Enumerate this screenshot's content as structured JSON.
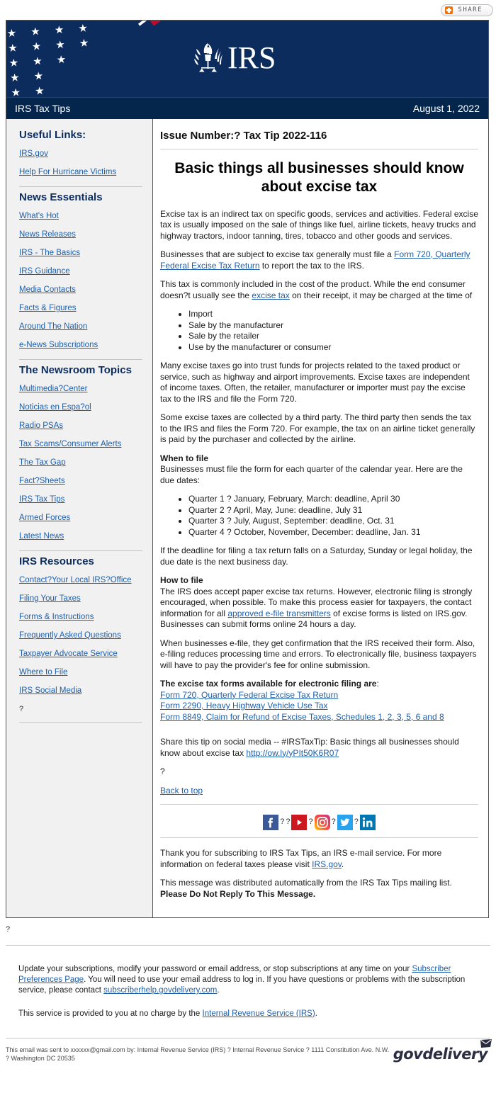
{
  "share": {
    "label": "SHARE",
    "icon": "share-plus-icon"
  },
  "banner": {
    "logo_text": "IRS",
    "flag_alt": "us-flag"
  },
  "titlebar": {
    "title": "IRS Tax Tips",
    "date": "August 1, 2022"
  },
  "sidebar": {
    "useful_links_heading": "Useful Links:",
    "useful_links": [
      "IRS.gov",
      "Help For Hurricane Victims"
    ],
    "news_essentials_heading": "News Essentials",
    "news_essentials": [
      "What's Hot",
      "News Releases",
      "IRS - The Basics",
      "IRS Guidance",
      "Media Contacts",
      "Facts & Figures",
      "Around The Nation",
      "e-News Subscriptions"
    ],
    "newsroom_heading": "The Newsroom Topics",
    "newsroom_topics": [
      "Multimedia?Center",
      "Noticias en Espa?ol",
      "Radio PSAs",
      "Tax Scams/Consumer Alerts",
      "The Tax Gap",
      "Fact?Sheets",
      "IRS Tax Tips",
      "Armed Forces",
      "Latest News"
    ],
    "resources_heading": "IRS Resources",
    "resources": [
      "Contact?Your Local IRS?Office",
      "Filing Your Taxes",
      "Forms & Instructions",
      "Frequently Asked Questions",
      "Taxpayer Advocate Service",
      "Where to File",
      "IRS Social Media"
    ],
    "resources_trailing": "?"
  },
  "content": {
    "issue_number": "Issue Number:? Tax Tip 2022-116",
    "headline": "Basic things all businesses should know about excise tax",
    "p1": "Excise tax is an indirect tax on specific goods, services and activities. Federal excise tax is usually imposed on the sale of things like fuel, airline tickets, heavy trucks and highway tractors, indoor tanning, tires, tobacco and other goods and services.",
    "p2_before": "Businesses that are subject to excise tax generally must file a ",
    "p2_link": "Form 720, Quarterly Federal Excise Tax Return",
    "p2_after": " to report the tax to the IRS.",
    "p3_before": "This tax is commonly included in the cost of the product. While the end consumer doesn?t usually see the ",
    "p3_link": "excise tax",
    "p3_after": " on their receipt, it may be charged at the time of",
    "list1": [
      "Import",
      "Sale by the manufacturer",
      "Sale by the retailer",
      "Use by the manufacturer or consumer"
    ],
    "p4": "Many excise taxes go into trust funds for projects related to the taxed product or service, such as highway and airport improvements. Excise taxes are independent of income taxes. Often, the retailer, manufacturer or importer must pay the excise tax to the IRS and file the Form 720.",
    "p5": "Some excise taxes are collected by a third party. The third party then sends the tax to the IRS and files the Form 720. For example, the tax on an airline ticket generally is paid by the purchaser and collected by the airline.",
    "when_to_file_heading": "When to file",
    "when_to_file_text": "Businesses must file the form for each quarter of the calendar year. Here are the due dates:",
    "quarters": [
      "Quarter 1 ? January, February, March: deadline, April 30",
      "Quarter 2 ? April, May, June: deadline, July 31",
      "Quarter 3 ? July, August, September: deadline, Oct. 31",
      "Quarter 4 ? October, November, December: deadline, Jan. 31"
    ],
    "p6": "If the deadline for filing a tax return falls on a Saturday, Sunday or legal holiday, the due date is the next business day.",
    "how_to_file_heading": "How to file",
    "p7_before": "The IRS does accept paper excise tax returns. However, electronic filing is strongly encouraged, when possible. To make this process easier for taxpayers, the contact information for all ",
    "p7_link": "approved e-file transmitters",
    "p7_after": " of excise forms is listed on IRS.gov. Businesses can submit forms online 24 hours a day.",
    "p8": "When businesses e-file, they get confirmation that the IRS received their form. Also, e-filing reduces processing time and errors. To electronically file, business taxpayers will have to pay the provider's fee for online submission.",
    "forms_heading_bold": "The excise tax forms available for electronic filing are",
    "forms_heading_tail": ":",
    "forms": [
      "Form 720, Quarterly Federal Excise Tax Return",
      "Form 2290, Heavy Highway Vehicle Use Tax",
      "Form 8849, Claim for Refund of Excise Taxes, Schedules 1, 2, 3, 5, 6 and 8"
    ],
    "share_tip_text": "Share this tip on social media -- #IRSTaxTip: Basic things all businesses should know about excise tax ",
    "share_tip_url": "http://ow.ly/yPIt50K6R07",
    "trailing_q": "?",
    "back_to_top": "Back to top",
    "social_separator": "?",
    "social_icons": [
      "facebook-icon",
      "youtube-icon",
      "instagram-icon",
      "twitter-icon",
      "linkedin-icon"
    ],
    "thanks_before": "Thank you for subscribing to IRS Tax Tips, an IRS e-mail service. For more information on federal taxes please visit ",
    "thanks_link": "IRS.gov",
    "thanks_after": ".",
    "distributed_text": "This message was distributed automatically from the IRS Tax Tips mailing list. ",
    "distributed_bold": "Please Do Not Reply To This Message."
  },
  "footer": {
    "stray_q": "?",
    "update_before": "Update your subscriptions, modify your password or email address, or stop subscriptions at any time on your ",
    "update_link1": "Subscriber Preferences Page",
    "update_mid": ". You will need to use your email address to log in. If you have questions or problems with the subscription service, please contact ",
    "update_link2": "subscriberhelp.govdelivery.com",
    "update_after": ".",
    "service_before": "This service is provided to you at no charge by the ",
    "service_link": "Internal Revenue Service (IRS)",
    "service_after": ".",
    "legal_text": "This email was sent to xxxxxx@gmail.com by: Internal Revenue Service (IRS) ? Internal Revenue Service ? 1111 Constitution Ave. N.W. ? Washington DC 20535",
    "govdelivery_word": "govdelivery"
  },
  "colors": {
    "banner_navy": "#0b2c5d",
    "titlebar_navy": "#04264d",
    "link_blue": "#1f5fa9",
    "heading_navy": "#0b2c5d",
    "flag_red": "#bf0a30",
    "share_orange": "#f0700a",
    "facebook": "#3b5998",
    "youtube": "#cc181e",
    "twitter": "#2aa3ef",
    "linkedin": "#0077b5"
  }
}
